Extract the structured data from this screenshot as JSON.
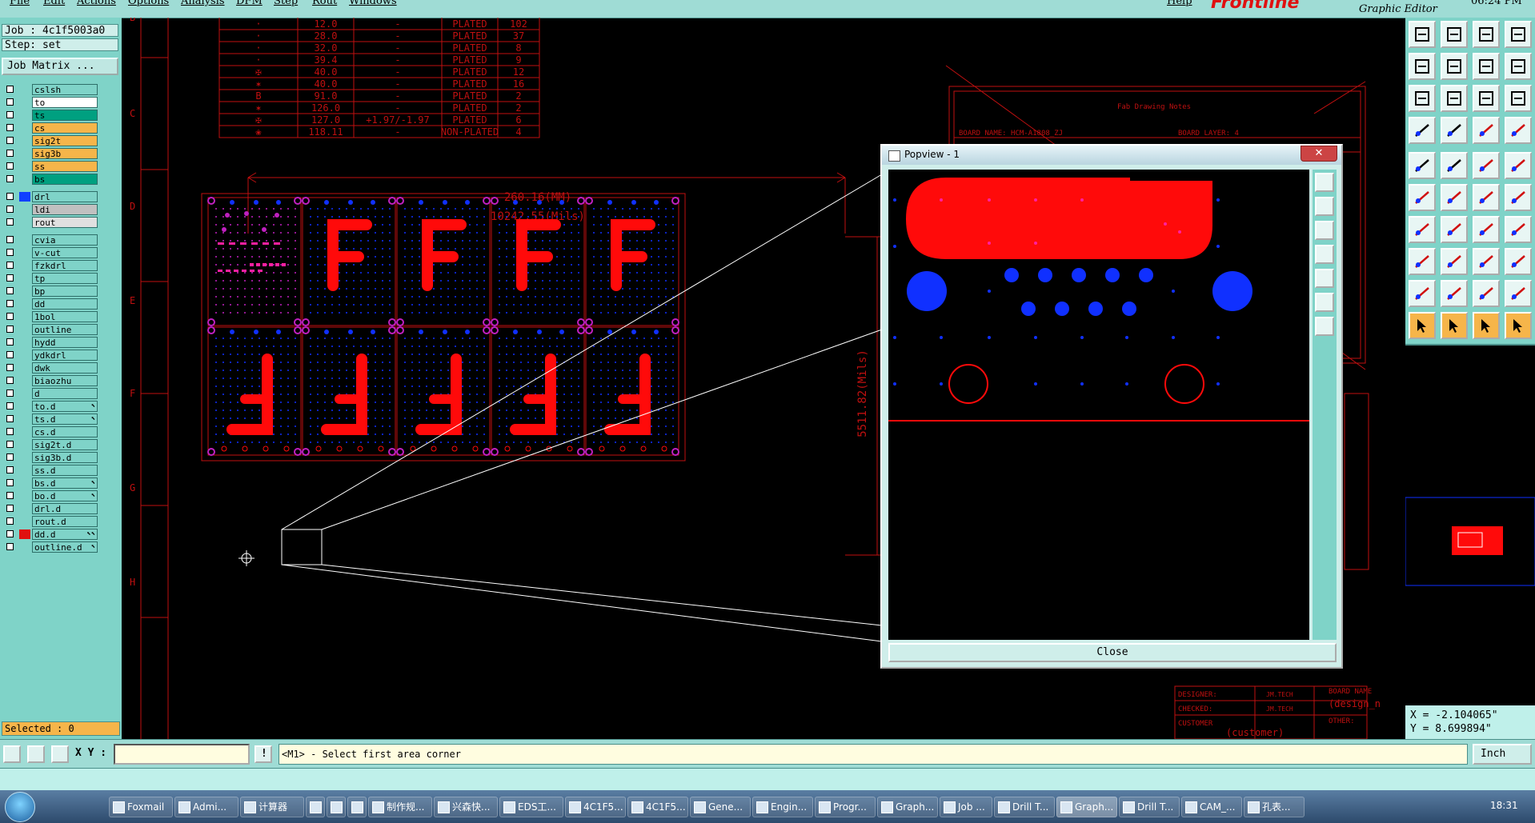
{
  "menubar": {
    "items": [
      "File",
      "Edit",
      "Actions",
      "Options",
      "Analysis",
      "DFM",
      "Step",
      "Rout",
      "Windows"
    ],
    "help": "Help",
    "brand": "Frontline",
    "brand_sub": "Graphic Editor",
    "time": "06:24 PM"
  },
  "job": {
    "job_line": "Job : 4c1f5003a0",
    "step_line": "Step: set",
    "matrix_button": "Job Matrix ..."
  },
  "layers": [
    {
      "name": "cslsh",
      "color": "#7fd3c8",
      "group": 1
    },
    {
      "name": "to",
      "color": "#ffffff",
      "group": 1
    },
    {
      "name": "ts",
      "color": "#00a080",
      "group": 1
    },
    {
      "name": "cs",
      "color": "#f6b54a",
      "group": 1
    },
    {
      "name": "sig2t",
      "color": "#f6b54a",
      "group": 1
    },
    {
      "name": "sig3b",
      "color": "#f6b54a",
      "group": 1
    },
    {
      "name": "ss",
      "color": "#f6b54a",
      "group": 1
    },
    {
      "name": "bs",
      "color": "#00a080",
      "group": 1
    },
    {
      "name": "drl",
      "color": "#7fd3c8",
      "swatch": "#1040ff",
      "group": 2
    },
    {
      "name": "ldi",
      "color": "#c0c0c0",
      "group": 2
    },
    {
      "name": "rout",
      "color": "#e0e0e0",
      "group": 2
    },
    {
      "name": "cvia",
      "color": "#7fd3c8",
      "group": 3
    },
    {
      "name": "v-cut",
      "color": "#7fd3c8",
      "group": 3
    },
    {
      "name": "fzkdrl",
      "color": "#7fd3c8",
      "group": 3
    },
    {
      "name": "tp",
      "color": "#7fd3c8",
      "group": 3
    },
    {
      "name": "bp",
      "color": "#7fd3c8",
      "group": 3
    },
    {
      "name": "dd",
      "color": "#7fd3c8",
      "group": 3
    },
    {
      "name": "1bol",
      "color": "#7fd3c8",
      "group": 3
    },
    {
      "name": "outline",
      "color": "#7fd3c8",
      "group": 3
    },
    {
      "name": "hydd",
      "color": "#7fd3c8",
      "group": 3
    },
    {
      "name": "ydkdrl",
      "color": "#7fd3c8",
      "group": 3
    },
    {
      "name": "dwk",
      "color": "#7fd3c8",
      "group": 3
    },
    {
      "name": "biaozhu",
      "color": "#7fd3c8",
      "group": 3
    },
    {
      "name": "d",
      "color": "#7fd3c8",
      "group": 3
    },
    {
      "name": "to.d",
      "color": "#7fd3c8",
      "arrow": "⬉",
      "group": 3
    },
    {
      "name": "ts.d",
      "color": "#7fd3c8",
      "arrow": "⬉",
      "group": 3
    },
    {
      "name": "cs.d",
      "color": "#7fd3c8",
      "group": 3
    },
    {
      "name": "sig2t.d",
      "color": "#7fd3c8",
      "group": 3
    },
    {
      "name": "sig3b.d",
      "color": "#7fd3c8",
      "group": 3
    },
    {
      "name": "ss.d",
      "color": "#7fd3c8",
      "group": 3
    },
    {
      "name": "bs.d",
      "color": "#7fd3c8",
      "arrow": "⬉",
      "group": 3
    },
    {
      "name": "bo.d",
      "color": "#7fd3c8",
      "arrow": "⬉",
      "group": 3
    },
    {
      "name": "drl.d",
      "color": "#7fd3c8",
      "group": 3
    },
    {
      "name": "rout.d",
      "color": "#7fd3c8",
      "group": 3
    },
    {
      "name": "dd.d",
      "color": "#7fd3c8",
      "swatch": "#e01010",
      "arrow": "⬉⬉",
      "group": 3
    },
    {
      "name": "outline.d",
      "color": "#7fd3c8",
      "arrow": "⬉",
      "group": 3
    }
  ],
  "selected": "Selected : 0",
  "drill_table": [
    [
      "·",
      "12.0",
      "-",
      "PLATED",
      "102"
    ],
    [
      "·",
      "28.0",
      "-",
      "PLATED",
      "37"
    ],
    [
      "·",
      "32.0",
      "-",
      "PLATED",
      "8"
    ],
    [
      "·",
      "39.4",
      "-",
      "PLATED",
      "9"
    ],
    [
      "✠",
      "40.0",
      "-",
      "PLATED",
      "12"
    ],
    [
      "✶",
      "40.0",
      "-",
      "PLATED",
      "16"
    ],
    [
      "B",
      "91.0",
      "-",
      "PLATED",
      "2"
    ],
    [
      "✶",
      "126.0",
      "-",
      "PLATED",
      "2"
    ],
    [
      "✠",
      "127.0",
      "+1.97/-1.97",
      "PLATED",
      "6"
    ],
    [
      "❀",
      "118.11",
      "-",
      "NON-PLATED",
      "4"
    ]
  ],
  "dimensions": {
    "width_mm": "260.16(MM)",
    "width_mils": "10242.55(Mils)",
    "height_mils": "5511.82(Mils)"
  },
  "ruler_letters": [
    "B",
    "C",
    "D",
    "E",
    "F",
    "G",
    "H"
  ],
  "drawing_notes": {
    "title": "Fab Drawing Notes",
    "board_name": "BOARD NAME:  HCM-A1808_ZJ",
    "board_layer": "BOARD LAYER:  4"
  },
  "title_block": {
    "designer": "DESIGNER:",
    "checked": "CHECKED:",
    "customer": "CUSTOMER",
    "customer_val": "(customer)",
    "board_name": "BOARD NAME",
    "design_val": "(design_n",
    "other": "OTHER:",
    "company": "JM.TECH"
  },
  "popview": {
    "title": "Popview - 1",
    "close_x": "✕",
    "close_button": "Close"
  },
  "coords": {
    "x": "X = -2.104065\"",
    "y": "Y = 8.699894\""
  },
  "cmd": {
    "xy_label": "X Y :",
    "xy_value": "",
    "prompt": "<M1> - Select first area corner",
    "units": "Inch"
  },
  "taskbar": {
    "items": [
      "Foxmail",
      "Admi...",
      "计算器",
      "",
      "",
      "",
      "制作规...",
      "兴森快...",
      "EDS工...",
      "4C1F5...",
      "4C1F5...",
      "Gene...",
      "Engin...",
      "Progr...",
      "Graph...",
      "Job ...",
      "Drill T...",
      "Graph...",
      "Drill T...",
      "CAM_...",
      "孔表..."
    ],
    "active_index": 17,
    "clock": "18:31"
  },
  "colors": {
    "panel": "#7fd3c8",
    "red": "#e01010",
    "blue": "#1030ff",
    "magenta": "#c020c0"
  }
}
